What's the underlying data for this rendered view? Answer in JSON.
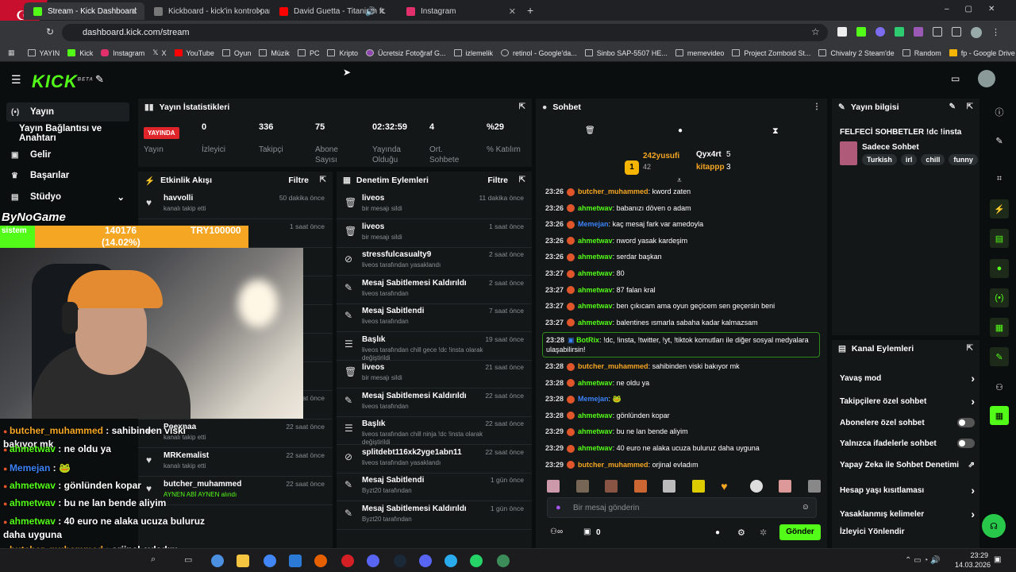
{
  "browser": {
    "tabs": [
      {
        "title": "Stream - Kick Dashboard",
        "color": "#53fc18"
      },
      {
        "title": "Kickboard - kick'in kontrol pan...",
        "color": "#4a4a4a"
      },
      {
        "title": "David Guetta - Titanium ft.",
        "color": "#ff0000"
      },
      {
        "title": "Instagram",
        "color": "#e1306c"
      }
    ],
    "url": "dashboard.kick.com/stream",
    "bookmarks": [
      "YAYIN",
      "Kick",
      "Instagram",
      "X",
      "YouTube",
      "Oyun",
      "Müzik",
      "PC",
      "Kripto",
      "Ücretsiz Fotoğraf G...",
      "izlemelik",
      "retinol - Google'da...",
      "Sinbo SAP-5507 HE...",
      "memevideo",
      "Project Zomboid St...",
      "Chivalry 2 Steam'de",
      "Random",
      "fp - Google Drive"
    ]
  },
  "kick": {
    "logo": "KICK",
    "beta": "BETA"
  },
  "sidebar": {
    "items": [
      "Yayın",
      "Yayın Bağlantısı ve Anahtarı",
      "Gelir",
      "Başarılar",
      "Stüdyo"
    ]
  },
  "stats": {
    "title": "Yayın İstatistikleri",
    "live_badge": "YAYINDA",
    "items": [
      {
        "value": "",
        "label": "Yayın"
      },
      {
        "value": "0",
        "label": "İzleyici"
      },
      {
        "value": "336",
        "label": "Takipçi"
      },
      {
        "value": "75",
        "label": "Abone Sayısı"
      },
      {
        "value": "02:32:59",
        "label": "Yayında Olduğu"
      },
      {
        "value": "4",
        "label": "Ort. Sohbete"
      },
      {
        "value": "%29",
        "label": "% Katılım"
      }
    ]
  },
  "activity": {
    "title": "Etkinlik Akışı",
    "filter": "Filtre",
    "items": [
      {
        "name": "havvolli",
        "sub": "kanalı takip etti",
        "time": "50 dakika önce"
      },
      {
        "name": "",
        "sub": "",
        "time": "1 saat önce"
      },
      {
        "name": "",
        "sub": "",
        "time": ""
      },
      {
        "name": "",
        "sub": "",
        "time": ""
      },
      {
        "name": "",
        "sub": "",
        "time": ""
      },
      {
        "name": "",
        "sub": "",
        "time": ""
      },
      {
        "name": "",
        "sub": "",
        "time": ""
      },
      {
        "name": "",
        "sub": "SU İÇ (YUDUM) alındı",
        "time": "21 saat önce"
      },
      {
        "name": "Poexnaa",
        "sub": "kanalı takip etti",
        "time": "22 saat önce"
      },
      {
        "name": "MRKemalist",
        "sub": "kanalı takip etti",
        "time": "22 saat önce"
      },
      {
        "name": "butcher_muhammed",
        "sub": "AYNEN ABİ AYNEN alındı",
        "time": "22 saat önce"
      }
    ]
  },
  "moderation": {
    "title": "Denetim Eylemleri",
    "filter": "Filtre",
    "items": [
      {
        "name": "liveos",
        "sub": "bir mesajı sildi",
        "time": "11 dakika önce",
        "icon": "🗑"
      },
      {
        "name": "liveos",
        "sub": "bir mesajı sildi",
        "time": "1 saat önce",
        "icon": "🗑"
      },
      {
        "name": "stressfulcasualty9",
        "sub": "liveos tarafından yasaklandı",
        "time": "2 saat önce",
        "icon": "⊘"
      },
      {
        "name": "Mesaj Sabitlemesi Kaldırıldı",
        "sub": "liveos tarafından",
        "time": "2 saat önce",
        "icon": "✎"
      },
      {
        "name": "Mesaj Sabitlendi",
        "sub": "liveos tarafından",
        "time": "7 saat önce",
        "icon": "✎"
      },
      {
        "name": "Başlık",
        "sub": "liveos tarafından chill gece !dc !insta olarak değiştirildi",
        "time": "19 saat önce",
        "icon": "☰"
      },
      {
        "name": "liveos",
        "sub": "bir mesajı sildi",
        "time": "21 saat önce",
        "icon": "🗑"
      },
      {
        "name": "Mesaj Sabitlemesi Kaldırıldı",
        "sub": "liveos tarafından",
        "time": "22 saat önce",
        "icon": "✎"
      },
      {
        "name": "Başlık",
        "sub": "liveos tarafından chill ninja !dc !insta olarak değiştirildi",
        "time": "22 saat önce",
        "icon": "☰"
      },
      {
        "name": "splitdebt116xk2yge1abn11",
        "sub": "liveos tarafından yasaklandı",
        "time": "22 saat önce",
        "icon": "⊘"
      },
      {
        "name": "Mesaj Sabitlendi",
        "sub": "Byzt20 tarafından",
        "time": "1 gün önce",
        "icon": "✎"
      },
      {
        "name": "Mesaj Sabitlemesi Kaldırıldı",
        "sub": "Byzt20 tarafından",
        "time": "1 gün önce",
        "icon": "✎"
      }
    ]
  },
  "chat": {
    "title": "Sohbet",
    "top_user": "242yusufi",
    "top_count": "42",
    "top_user2": "Qyx4rt",
    "top_count2": "5",
    "top_user3": "kitappp",
    "top_count3": "3",
    "messages": [
      {
        "time": "23:26",
        "user": "butcher_muhammed",
        "color": "#f5a623",
        "text": "kword zaten"
      },
      {
        "time": "23:26",
        "user": "ahmetwav",
        "color": "#53fc18",
        "text": "babanızı döven o adam"
      },
      {
        "time": "23:26",
        "user": "Memejan",
        "color": "#3b82f6",
        "text": "kaç mesaj fark var amedoyla"
      },
      {
        "time": "23:26",
        "user": "ahmetwav",
        "color": "#53fc18",
        "text": "nword yasak kardeşim"
      },
      {
        "time": "23:26",
        "user": "ahmetwav",
        "color": "#53fc18",
        "text": "serdar başkan"
      },
      {
        "time": "23:27",
        "user": "ahmetwav",
        "color": "#53fc18",
        "text": "80"
      },
      {
        "time": "23:27",
        "user": "ahmetwav",
        "color": "#53fc18",
        "text": "87 falan kral"
      },
      {
        "time": "23:27",
        "user": "ahmetwav",
        "color": "#53fc18",
        "text": "ben çıkıcam ama oyun geçicem sen geçersin beni"
      },
      {
        "time": "23:27",
        "user": "ahmetwav",
        "color": "#53fc18",
        "text": "balentines ısmarla sabaha kadar kalmazsam"
      }
    ],
    "bot_message": {
      "time": "23:28",
      "user": "BotRix",
      "text": "!dc, !insta, !twitter, !yt, !tiktok komutları ile diğer sosyal medyalara ulaşabilirsin!"
    },
    "messages2": [
      {
        "time": "23:28",
        "user": "butcher_muhammed",
        "color": "#f5a623",
        "text": "sahibinden viski bakıyor mk"
      },
      {
        "time": "23:28",
        "user": "ahmetwav",
        "color": "#53fc18",
        "text": "ne oldu ya"
      },
      {
        "time": "23:28",
        "user": "Memejan",
        "color": "#3b82f6",
        "text": "🐸"
      },
      {
        "time": "23:28",
        "user": "ahmetwav",
        "color": "#53fc18",
        "text": "gönlünden kopar"
      },
      {
        "time": "23:29",
        "user": "ahmetwav",
        "color": "#53fc18",
        "text": "bu ne lan bende aliyim"
      },
      {
        "time": "23:29",
        "user": "ahmetwav",
        "color": "#53fc18",
        "text": "40 euro ne alaka ucuza buluruz daha uyguna"
      },
      {
        "time": "23:29",
        "user": "butcher_muhammed",
        "color": "#f5a623",
        "text": "orjinal evladım"
      }
    ],
    "input_placeholder": "Bir mesaj gönderin",
    "send": "Gönder",
    "counter": "0"
  },
  "info": {
    "title": "Yayın bilgisi",
    "stream_title": "FELFECİ SOHBETLER !dc !insta",
    "category": "Sadece Sohbet",
    "tags": [
      "Turkish",
      "irl",
      "chill",
      "funny"
    ]
  },
  "channel": {
    "title": "Kanal Eylemleri",
    "items": [
      {
        "label": "Yavaş mod",
        "kind": "arrow"
      },
      {
        "label": "Takipçilere özel sohbet",
        "kind": "arrow"
      },
      {
        "label": "Abonelere özel sohbet",
        "kind": "toggle"
      },
      {
        "label": "Yalnızca ifadelerle sohbet",
        "kind": "toggle"
      },
      {
        "label": "Yapay Zeka ile Sohbet Denetimi",
        "kind": "ext"
      },
      {
        "label": "Hesap yaşı kısıtlaması",
        "kind": "arrow"
      },
      {
        "label": "Yasaklanmış kelimeler",
        "kind": "arrow"
      },
      {
        "label": "İzleyici Yönlendir",
        "kind": "none"
      }
    ]
  },
  "overlay": {
    "brand": "ByNoGame",
    "goal_left": "sistem",
    "goal_value": "140176",
    "goal_pct": "(14.02%)",
    "goal_target": "TRY100000",
    "chat": [
      {
        "user": "butcher_muhammed",
        "color": "#f5a623",
        "text": " : sahibinden viski bakıyor mk"
      },
      {
        "user": "ahmetwav",
        "color": "#53fc18",
        "text": " : ne oldu ya"
      },
      {
        "user": "Memejan",
        "color": "#3b82f6",
        "text": " : 🐸"
      },
      {
        "user": "ahmetwav",
        "color": "#53fc18",
        "text": " : gönlünden kopar"
      },
      {
        "user": "ahmetwav",
        "color": "#53fc18",
        "text": " : bu ne lan bende aliyim"
      },
      {
        "user": "ahmetwav",
        "color": "#53fc18",
        "text": " : 40 euro ne alaka ucuza buluruz daha uyguna"
      },
      {
        "user": "butcher_muhammed",
        "color": "#f5a623",
        "text": " : orjinal evladım"
      }
    ]
  },
  "taskbar": {
    "time": "23:29",
    "date": "14.03.2026"
  }
}
